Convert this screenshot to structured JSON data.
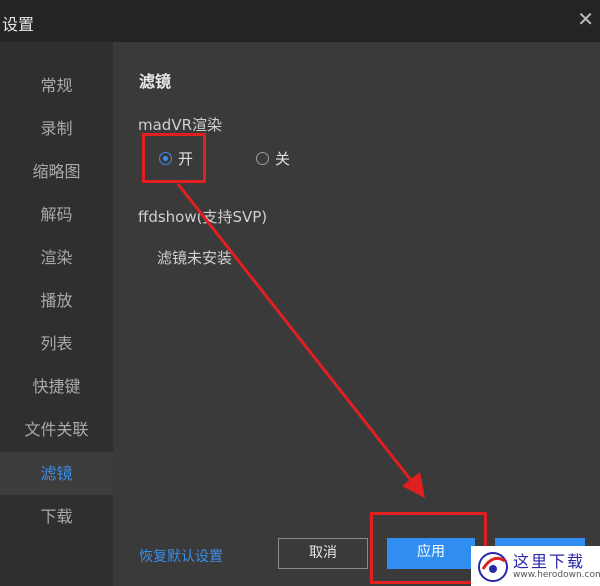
{
  "window": {
    "title": "设置",
    "close_glyph": "✕"
  },
  "sidebar": {
    "items": [
      {
        "label": "常规",
        "active": false
      },
      {
        "label": "录制",
        "active": false
      },
      {
        "label": "缩略图",
        "active": false
      },
      {
        "label": "解码",
        "active": false
      },
      {
        "label": "渲染",
        "active": false
      },
      {
        "label": "播放",
        "active": false
      },
      {
        "label": "列表",
        "active": false
      },
      {
        "label": "快捷键",
        "active": false
      },
      {
        "label": "文件关联",
        "active": false
      },
      {
        "label": "滤镜",
        "active": true
      },
      {
        "label": "下载",
        "active": false
      }
    ]
  },
  "main": {
    "section_title": "滤镜",
    "madvr": {
      "label": "madVR渲染",
      "options": [
        {
          "label": "开",
          "checked": true
        },
        {
          "label": "关",
          "checked": false
        }
      ]
    },
    "ffdshow": {
      "label": "ffdshow(支持SVP)",
      "status": "滤镜未安装"
    },
    "footer": {
      "restore_label": "恢复默认设置",
      "cancel_label": "取消",
      "apply_label": "应用"
    }
  },
  "watermark": {
    "title": "这里下载",
    "url": "www.herodown.com"
  },
  "colors": {
    "accent": "#2f8ef0",
    "annotation_red": "#e02020",
    "sidebar_bg": "#2f2f2f",
    "content_bg": "#3a3a3a"
  }
}
